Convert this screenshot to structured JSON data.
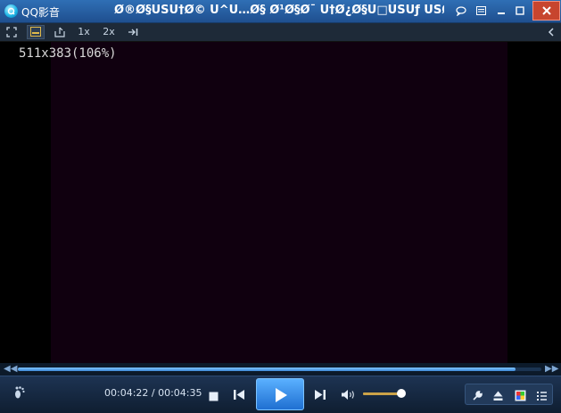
{
  "window": {
    "app_name": "QQ影音",
    "title": "Ø®Ø§ÙŠÙ†Ø© Ù^Ù…Ø§ Ø¹Ø§Ø¯ Ù†Ø¿Ø§Ù□ÙŠÙƒ ÙŠØ§Ù‚..."
  },
  "titlebar_buttons": [
    {
      "icon": "chat-bubble-icon",
      "glyph": "💬"
    },
    {
      "icon": "menu-icon",
      "glyph": "☰"
    },
    {
      "icon": "minimize-icon",
      "glyph": "—"
    },
    {
      "icon": "maximize-icon",
      "glyph": "□"
    },
    {
      "icon": "close-icon",
      "glyph": "✕"
    }
  ],
  "toolbar": {
    "zoom_1x": "1x",
    "zoom_2x": "2x"
  },
  "video": {
    "info": "511x383(106%)"
  },
  "playback": {
    "current_time": "00:04:22",
    "total_time": "00:04:35",
    "time_display": "00:04:22 / 00:04:35",
    "progress": 0.951,
    "volume": 0.95
  },
  "colors": {
    "titlebar": "#2f6fb5",
    "close": "#c7452e",
    "video_bg": "#10000f",
    "play_button": "#1f6fd1",
    "seek_fill": "#3d88d6",
    "volume": "#caa248"
  }
}
